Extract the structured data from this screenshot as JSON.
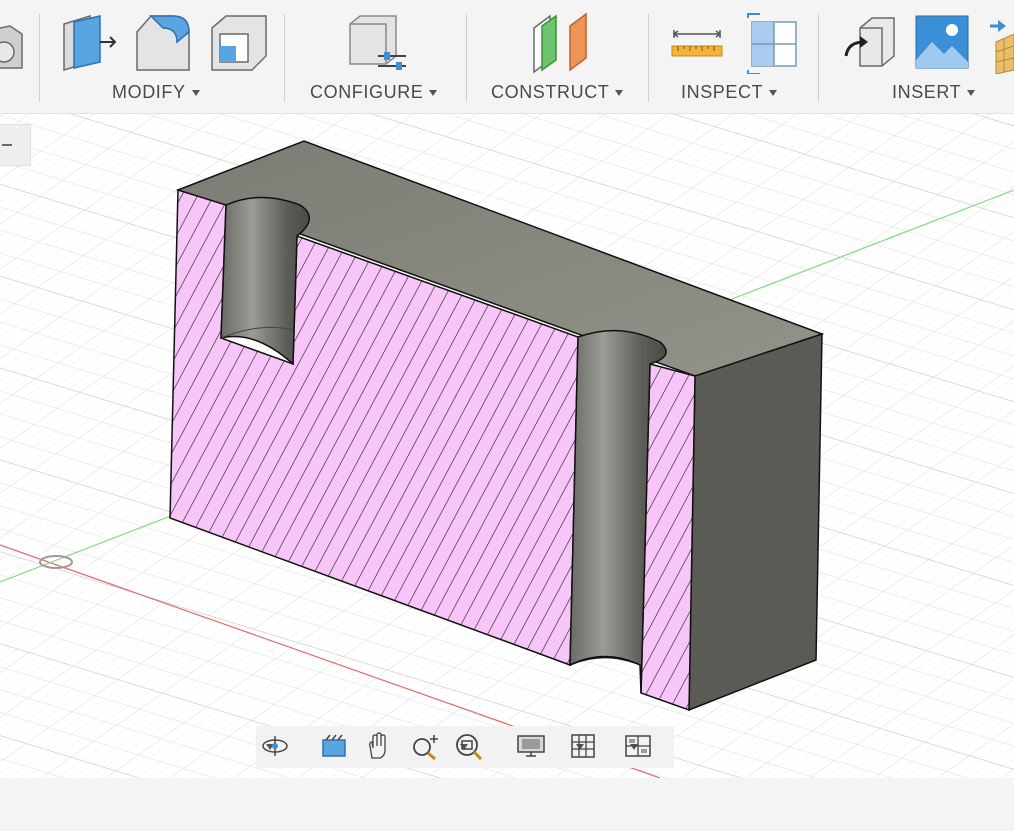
{
  "toolbar": {
    "groups": [
      {
        "label": "MODIFY"
      },
      {
        "label": "CONFIGURE"
      },
      {
        "label": "CONSTRUCT"
      },
      {
        "label": "INSPECT"
      },
      {
        "label": "INSERT"
      }
    ],
    "icons": [
      "partial-cut-icon",
      "press-pull-icon",
      "fillet-icon",
      "shell-icon",
      "configure-parameters-icon",
      "offset-plane-icon",
      "measure-icon",
      "section-analysis-icon",
      "insert-derive-icon",
      "insert-canvas-icon",
      "insert-mesh-icon"
    ]
  },
  "viewport": {
    "model": "section-view-block-with-two-counterbores",
    "section_fill_color": "#f7c5f7",
    "body_color_top": "#8a8a82",
    "body_color_side": "#5b5b55",
    "grid_color": "#dcdcdc",
    "axis_x_color": "#e26a6a",
    "axis_y_color": "#7fdc7f"
  },
  "navbar": {
    "icons": [
      "orbit-icon",
      "look-at-icon",
      "pan-icon",
      "zoom-icon",
      "fit-icon",
      "display-settings-icon",
      "grid-settings-icon",
      "viewports-icon"
    ]
  }
}
